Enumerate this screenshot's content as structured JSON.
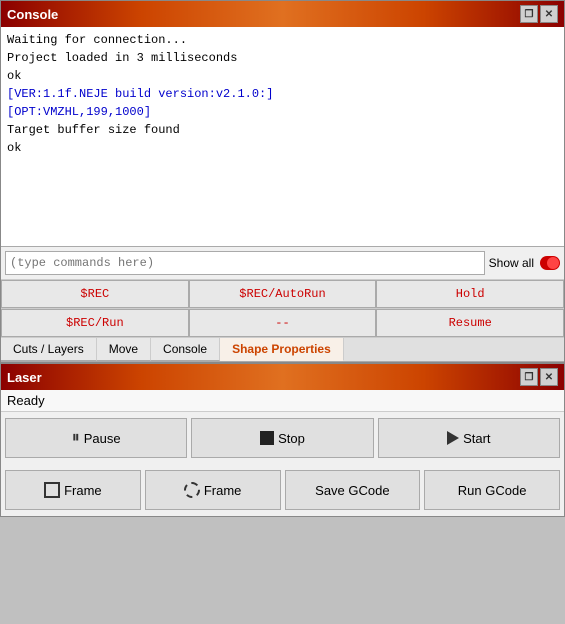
{
  "console_window": {
    "title": "Console",
    "output_lines": [
      {
        "text": "Waiting for connection...",
        "color": "black"
      },
      {
        "text": "Project loaded in 3 milliseconds",
        "color": "black"
      },
      {
        "text": "ok",
        "color": "black"
      },
      {
        "text": "[VER:1.1f.NEJE build version:v2.1.0:]",
        "color": "blue"
      },
      {
        "text": "[OPT:VMZHL,199,1000]",
        "color": "blue"
      },
      {
        "text": "Target buffer size found",
        "color": "black"
      },
      {
        "text": "ok",
        "color": "black"
      }
    ],
    "input_placeholder": "(type commands here)",
    "show_all_label": "Show all",
    "buttons_row1": [
      {
        "label": "$REC",
        "id": "rec-btn"
      },
      {
        "label": "$REC/AutoRun",
        "id": "rec-autorun-btn"
      },
      {
        "label": "Hold",
        "id": "hold-btn"
      }
    ],
    "buttons_row2": [
      {
        "label": "$REC/Run",
        "id": "rec-run-btn"
      },
      {
        "label": "--",
        "id": "dash-btn"
      },
      {
        "label": "Resume",
        "id": "resume-btn"
      }
    ],
    "tabs": [
      {
        "label": "Cuts / Layers",
        "id": "tab-cuts"
      },
      {
        "label": "Move",
        "id": "tab-move"
      },
      {
        "label": "Console",
        "id": "tab-console",
        "active": true
      },
      {
        "label": "Shape Properties",
        "id": "tab-shape-props"
      }
    ]
  },
  "laser_window": {
    "title": "Laser",
    "status": "Ready",
    "buttons_row1": [
      {
        "label": "Pause",
        "id": "pause-btn",
        "icon": "pause"
      },
      {
        "label": "Stop",
        "id": "stop-btn",
        "icon": "stop"
      },
      {
        "label": "Start",
        "id": "start-btn",
        "icon": "play"
      }
    ],
    "buttons_row2": [
      {
        "label": "Frame",
        "id": "frame-square-btn",
        "icon": "frame-square"
      },
      {
        "label": "Frame",
        "id": "frame-circle-btn",
        "icon": "frame-circle"
      },
      {
        "label": "Save GCode",
        "id": "save-gcode-btn"
      },
      {
        "label": "Run GCode",
        "id": "run-gcode-btn"
      }
    ]
  },
  "icons": {
    "restore": "❐",
    "close": "✕"
  }
}
